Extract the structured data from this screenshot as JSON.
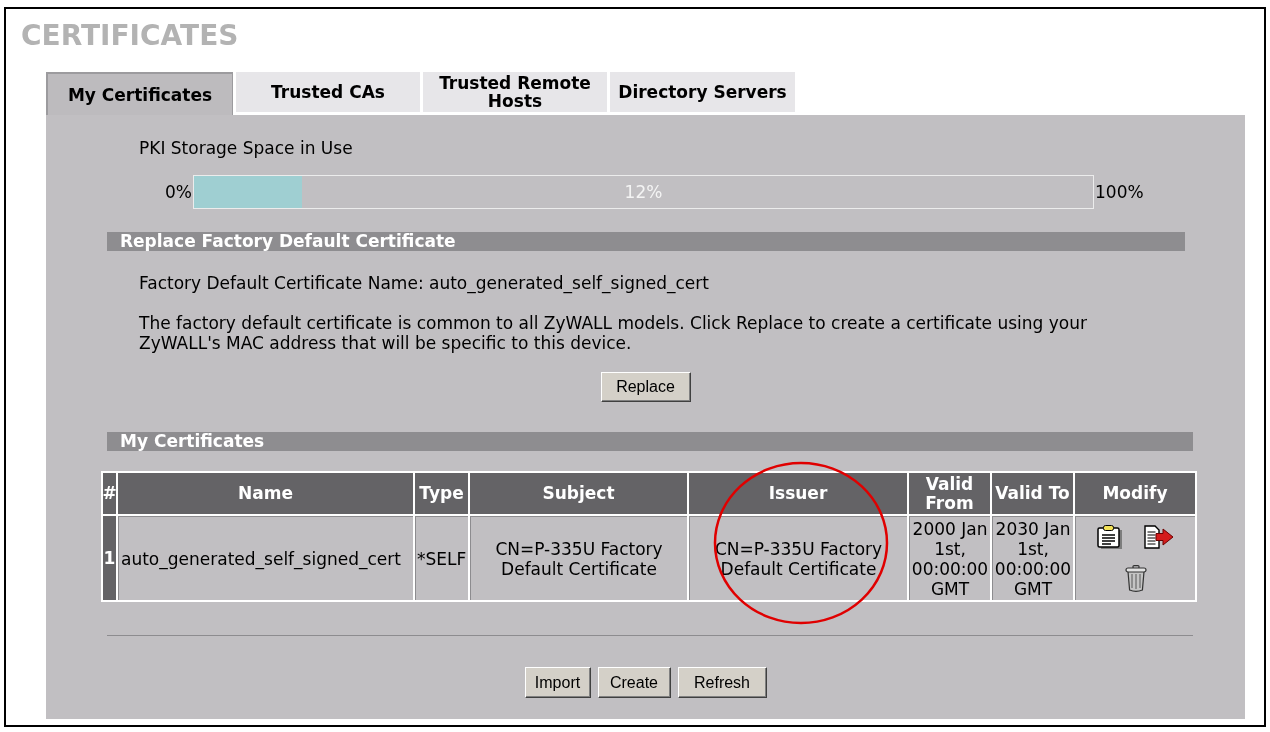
{
  "page": {
    "title": "CERTIFICATES"
  },
  "tabs": [
    {
      "label": "My Certificates",
      "selected": true
    },
    {
      "label": "Trusted CAs",
      "selected": false
    },
    {
      "label": "Trusted Remote Hosts",
      "selected": false
    },
    {
      "label": "Directory Servers",
      "selected": false
    }
  ],
  "storage": {
    "label": "PKI Storage Space in Use",
    "min_label": "0%",
    "reading": "12%",
    "max_label": "100%",
    "level": 0.12
  },
  "replace_section": {
    "heading": "Replace Factory Default Certificate",
    "name_line": "Factory Default Certificate Name: auto_generated_self_signed_cert",
    "description": "The factory default certificate is common to all ZyWALL models. Click Replace to create a certificate using your ZyWALL's MAC address that will be specific to this device.",
    "button": "Replace"
  },
  "certificates_section": {
    "heading": "My Certificates",
    "table": {
      "columns": [
        {
          "label": "#",
          "circled": false
        },
        {
          "label": "Name",
          "circled": false
        },
        {
          "label": "Type",
          "circled": false
        },
        {
          "label": "Subject",
          "circled": false
        },
        {
          "label": "Issuer",
          "circled": true
        },
        {
          "label": "Valid From",
          "circled": false
        },
        {
          "label": "Valid To",
          "circled": false
        },
        {
          "label": "Modify",
          "circled": false
        }
      ],
      "rows": [
        {
          "cells": [
            "1",
            "auto_generated_self_signed_cert",
            "*SELF",
            "CN=P-335U Factory Default Certificate",
            "CN=P-335U Factory Default Certificate",
            "2000 Jan 1st, 00:00:00 GMT",
            "2030 Jan 1st, 00:00:00 GMT"
          ]
        }
      ]
    }
  },
  "buttons": [
    "Import",
    "Create",
    "Refresh"
  ]
}
